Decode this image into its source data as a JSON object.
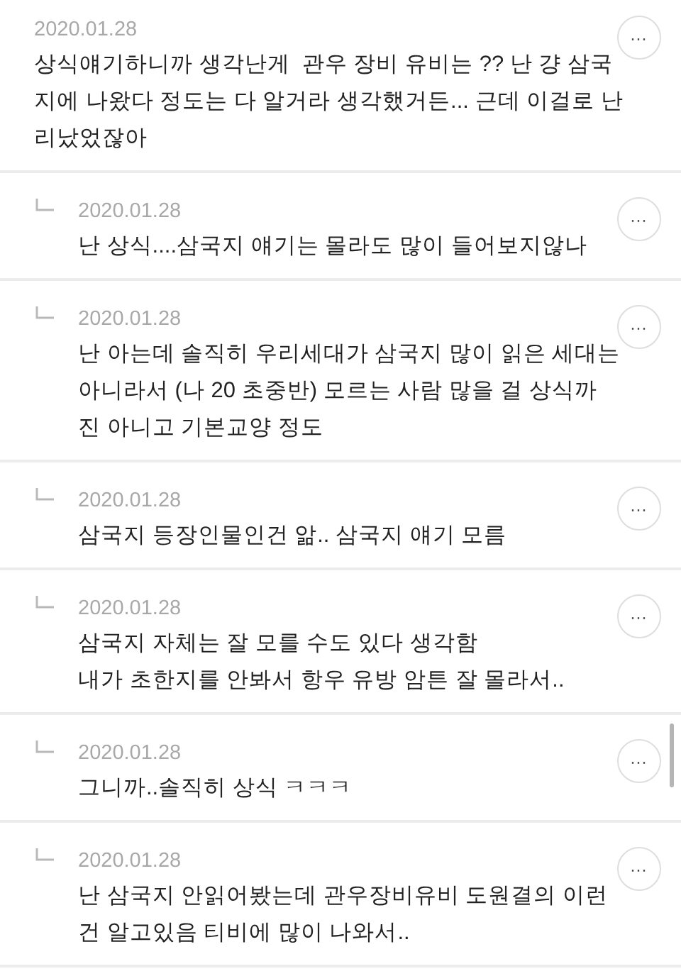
{
  "comments": [
    {
      "kind": "comment",
      "date": "2020.01.28",
      "text": "상식얘기하니까 생각난게  관우 장비 유비는 ?? 난 걍 삼국\n지에 나왔다 정도는 다 알거라 생각했거든... 근데 이걸로 난\n리났었잖아",
      "more": "···"
    },
    {
      "kind": "reply",
      "date": "2020.01.28",
      "text": "난 상식....삼국지 얘기는 몰라도 많이 들어보지않나",
      "more": "···"
    },
    {
      "kind": "reply",
      "date": "2020.01.28",
      "text": "난 아는데 솔직히 우리세대가 삼국지 많이 읽은 세대는\n아니라서 (나 20 초중반) 모르는 사람 많을 걸 상식까\n진 아니고 기본교양 정도",
      "more": "···"
    },
    {
      "kind": "reply",
      "date": "2020.01.28",
      "text": "삼국지 등장인물인건 앎.. 삼국지 얘기 모름",
      "more": "···"
    },
    {
      "kind": "reply",
      "date": "2020.01.28",
      "text": "삼국지 자체는 잘 모를 수도 있다 생각함\n내가 초한지를 안봐서 항우 유방 암튼 잘 몰라서..",
      "more": "···"
    },
    {
      "kind": "reply",
      "date": "2020.01.28",
      "text": "그니까..솔직히 상식 ㅋㅋㅋ",
      "more": "···"
    },
    {
      "kind": "reply",
      "date": "2020.01.28",
      "text": "난 삼국지 안읽어봤는데 관우장비유비 도원결의 이런\n건 알고있음 티비에 많이 나와서..",
      "more": "···"
    }
  ]
}
